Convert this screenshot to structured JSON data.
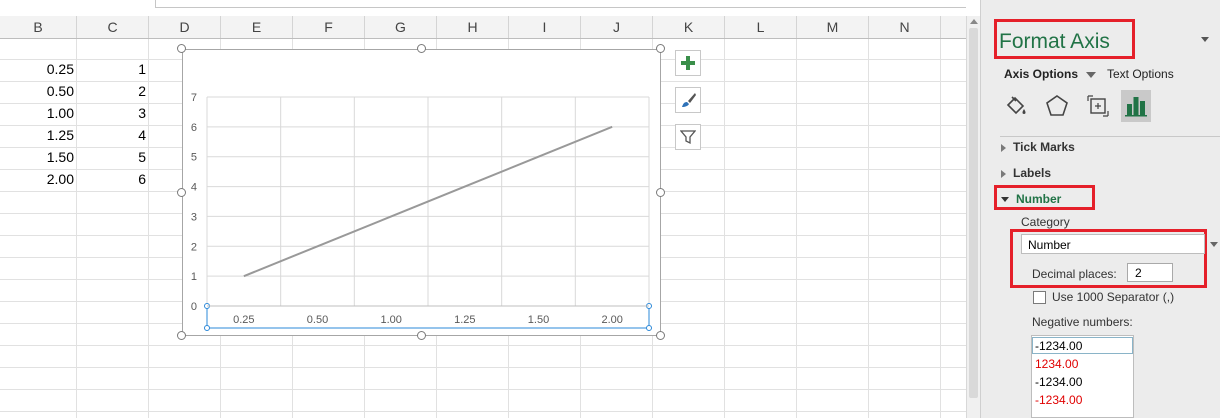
{
  "columns": [
    "B",
    "C",
    "D",
    "E",
    "F",
    "G",
    "H",
    "I",
    "J",
    "K",
    "L",
    "M",
    "N"
  ],
  "rows": [
    {
      "b": "0.25",
      "c": "1"
    },
    {
      "b": "0.50",
      "c": "2"
    },
    {
      "b": "1.00",
      "c": "3"
    },
    {
      "b": "1.25",
      "c": "4"
    },
    {
      "b": "1.50",
      "c": "5"
    },
    {
      "b": "2.00",
      "c": "6"
    }
  ],
  "chart_data": {
    "type": "line",
    "categories": [
      "0.25",
      "0.50",
      "1.00",
      "1.25",
      "1.50",
      "2.00"
    ],
    "series": [
      {
        "values": [
          1,
          2,
          3,
          4,
          5,
          6
        ]
      }
    ],
    "y_ticks": [
      "0",
      "1",
      "2",
      "3",
      "4",
      "5",
      "6",
      "7"
    ],
    "ylim": [
      0,
      7
    ],
    "grid": true,
    "line_color": "#999999"
  },
  "pane": {
    "title": "Format Axis",
    "tabs": {
      "axis_options": "Axis Options",
      "text_options": "Text Options"
    },
    "icons": [
      "fill-line-icon",
      "effects-icon",
      "size-properties-icon",
      "axis-options-icon"
    ],
    "sections": {
      "tick_marks": "Tick Marks",
      "labels": "Labels",
      "number": "Number"
    },
    "category_label": "Category",
    "category_value": "Number",
    "decimal_label": "Decimal places:",
    "decimal_value": "2",
    "separator_label": "Use 1000 Separator (,)",
    "negative_label": "Negative numbers:",
    "negative_options": [
      {
        "text": "-1234.00",
        "color": "#000000"
      },
      {
        "text": "1234.00",
        "color": "#e00000"
      },
      {
        "text": "-1234.00",
        "color": "#000000"
      },
      {
        "text": "-1234.00",
        "color": "#e00000"
      }
    ]
  },
  "colors": {
    "highlight": "#e5202a",
    "section_green": "#217346",
    "title_green": "#217346"
  }
}
